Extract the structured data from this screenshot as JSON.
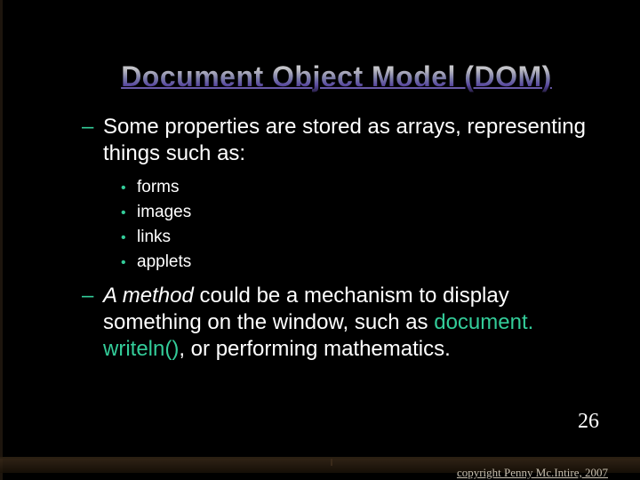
{
  "title": "Document Object Model (DOM)",
  "body": {
    "point1": {
      "bullet": "–",
      "text": "Some properties are stored as arrays, representing things such as:",
      "sub": [
        {
          "bullet": "•",
          "text": "forms"
        },
        {
          "bullet": "•",
          "text": "images"
        },
        {
          "bullet": "•",
          "text": "links"
        },
        {
          "bullet": "•",
          "text": "applets"
        }
      ]
    },
    "point2": {
      "bullet": "–",
      "parts": {
        "a": "A ",
        "b": "method",
        "c": " could be a mechanism to display something on the window, such as ",
        "d": "document. writeln()",
        "e": ", or performing mathematics."
      }
    }
  },
  "page_number": "26",
  "copyright": "copyright Penny Mc.Intire, 2007"
}
